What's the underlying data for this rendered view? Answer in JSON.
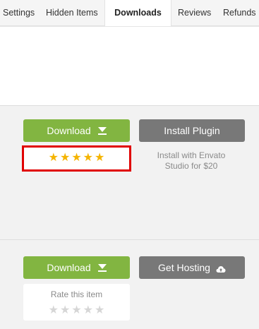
{
  "tabs": [
    {
      "label": "Settings",
      "active": false
    },
    {
      "label": "Hidden Items",
      "active": false
    },
    {
      "label": "Downloads",
      "active": true
    },
    {
      "label": "Reviews",
      "active": false
    },
    {
      "label": "Refunds",
      "active": false
    }
  ],
  "item1": {
    "download_label": "Download",
    "install_label": "Install Plugin",
    "install_note": "Install with Envato Studio for $20",
    "rating_value": 5,
    "rating_max": 5
  },
  "item2": {
    "download_label": "Download",
    "hosting_label": "Get Hosting",
    "rate_label": "Rate this item",
    "rating_value": 0,
    "rating_max": 5
  },
  "colors": {
    "green": "#82b541",
    "grey": "#787878",
    "star_gold": "#f5b400",
    "star_empty": "#d6d6d6",
    "highlight": "#e00000"
  },
  "icons": {
    "download": "download-arrow-icon",
    "hosting": "cloud-upload-icon",
    "star": "star-icon"
  }
}
